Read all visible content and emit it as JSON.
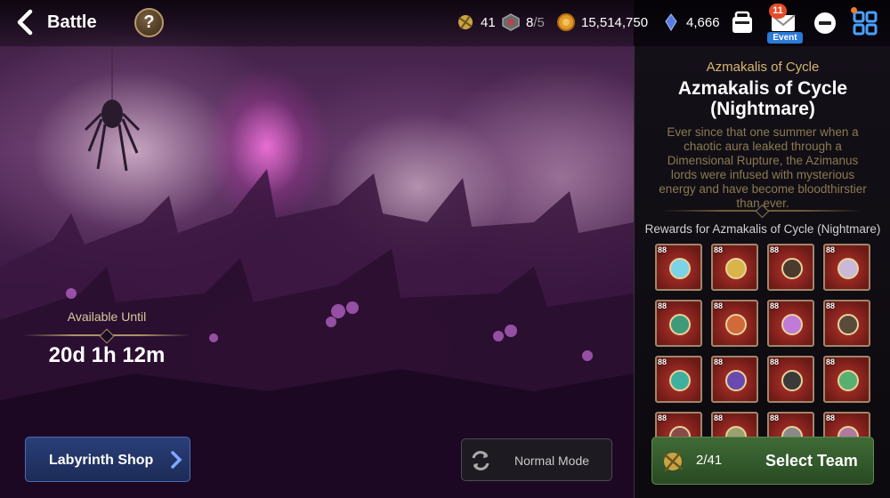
{
  "header": {
    "title": "Battle",
    "help_label": "?",
    "resources": [
      {
        "name": "stamina",
        "value": "41"
      },
      {
        "name": "tickets",
        "value": "8",
        "max": "/5"
      },
      {
        "name": "gold",
        "value": "15,514,750"
      },
      {
        "name": "crystals",
        "value": "4,666"
      }
    ],
    "mail_badge": "11",
    "event_label": "Event"
  },
  "event": {
    "available_label": "Available Until",
    "time_left": "20d 1h 12m"
  },
  "buttons": {
    "shop_label": "Labyrinth Shop",
    "mode_label": "Normal Mode",
    "team_count": "2/41",
    "select_label": "Select Team"
  },
  "panel": {
    "subtitle": "Azmakalis of Cycle",
    "title_line1": "Azmakalis of Cycle",
    "title_line2": "(Nightmare)",
    "description": "Ever since that one summer when a chaotic aura leaked through a Dimensional Rupture, the Azimanus lords were infused with mysterious energy and have become bloodthirstier than ever.",
    "rewards_label": "Rewards for Azmakalis of Cycle (Nightmare)"
  },
  "rewards": [
    {
      "level": "88",
      "icon": "ring-icon",
      "color": "#7ad3e6"
    },
    {
      "level": "88",
      "icon": "ring-icon",
      "color": "#d8b44a"
    },
    {
      "level": "88",
      "icon": "ring-icon",
      "color": "#4b3a2e"
    },
    {
      "level": "88",
      "icon": "necklace-icon",
      "color": "#c9b8d8"
    },
    {
      "level": "88",
      "icon": "necklace-icon",
      "color": "#3f9a7a"
    },
    {
      "level": "88",
      "icon": "necklace-icon",
      "color": "#d06a3a"
    },
    {
      "level": "88",
      "icon": "sword-icon",
      "color": "#c07ad8"
    },
    {
      "level": "88",
      "icon": "hammer-icon",
      "color": "#5a4a3a"
    },
    {
      "level": "88",
      "icon": "staff-icon",
      "color": "#3fb0a0"
    },
    {
      "level": "88",
      "icon": "axe-icon",
      "color": "#6a4ab0"
    },
    {
      "level": "88",
      "icon": "helmet-icon",
      "color": "#3a3a3a"
    },
    {
      "level": "88",
      "icon": "crown-icon",
      "color": "#58b070"
    },
    {
      "level": "88",
      "icon": "armor-icon",
      "color": "#8a4a4a"
    },
    {
      "level": "88",
      "icon": "armor-icon",
      "color": "#9aa070"
    },
    {
      "level": "88",
      "icon": "armor-icon",
      "color": "#8a8a8a"
    },
    {
      "level": "88",
      "icon": "armor-icon",
      "color": "#b07aa0"
    }
  ]
}
